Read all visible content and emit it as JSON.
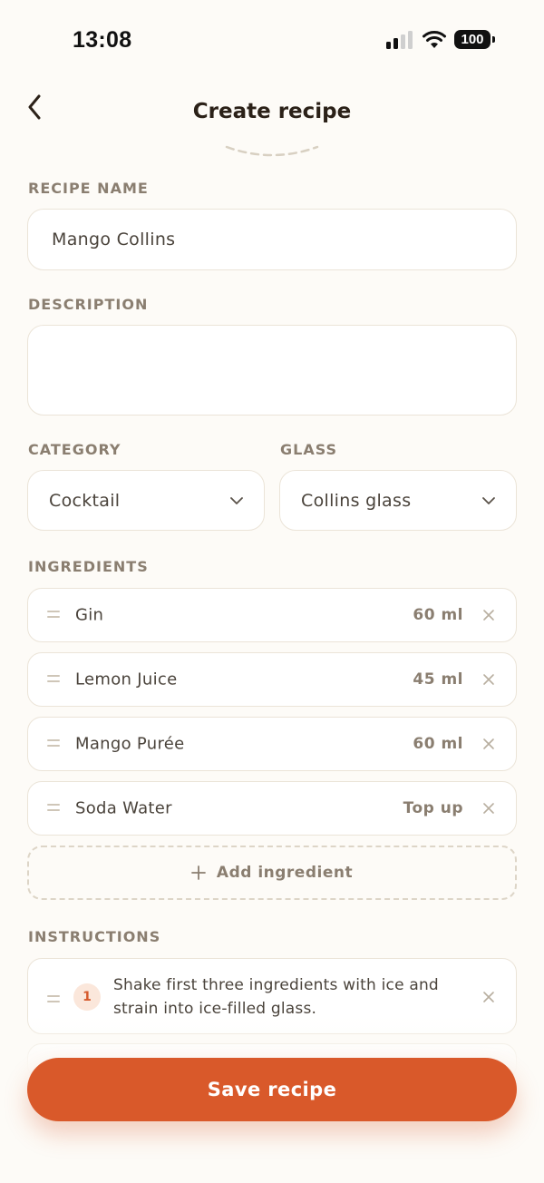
{
  "status_bar": {
    "time": "13:08",
    "battery": "100"
  },
  "header": {
    "title": "Create recipe",
    "back_icon": "chevron-left-icon"
  },
  "form": {
    "recipe_name": {
      "label": "RECIPE NAME",
      "value": "Mango Collins"
    },
    "description": {
      "label": "DESCRIPTION",
      "value": ""
    },
    "category": {
      "label": "CATEGORY",
      "value": "Cocktail"
    },
    "glass": {
      "label": "GLASS",
      "value": "Collins glass"
    }
  },
  "ingredients": {
    "label": "INGREDIENTS",
    "items": [
      {
        "name": "Gin",
        "amount": "60 ml"
      },
      {
        "name": "Lemon Juice",
        "amount": "45 ml"
      },
      {
        "name": "Mango Purée",
        "amount": "60 ml"
      },
      {
        "name": "Soda Water",
        "amount": "Top up"
      }
    ],
    "add_label": "Add ingredient"
  },
  "instructions": {
    "label": "INSTRUCTIONS",
    "items": [
      {
        "step": "1",
        "text": "Shake first three ingredients with ice and strain into ice-filled glass."
      }
    ]
  },
  "save_button": "Save recipe",
  "colors": {
    "accent": "#d9592a",
    "background": "#fdfbf7",
    "border": "#ebe4d8",
    "muted_text": "#8a7e70"
  }
}
